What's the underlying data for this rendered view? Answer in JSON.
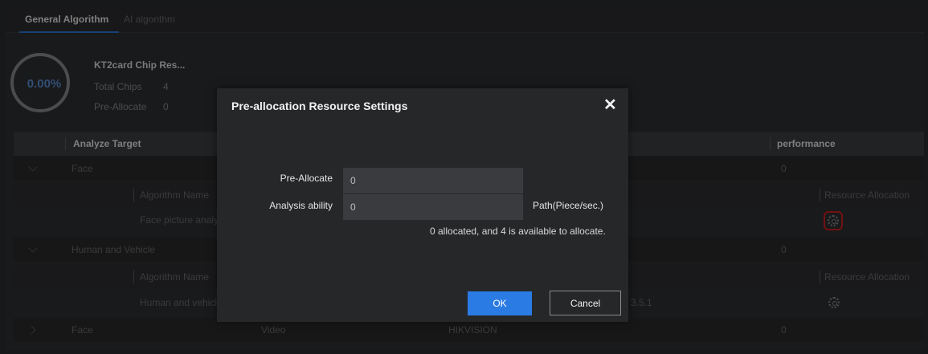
{
  "tabs": [
    {
      "label": "General Algorithm",
      "active": true
    },
    {
      "label": "AI algorithm",
      "active": false
    }
  ],
  "resource": {
    "percent": "0.00%",
    "title": "KT2card Chip Res...",
    "total_label": "Total Chips",
    "total_value": "4",
    "preallocate_label": "Pre-Allocate",
    "preallocate_value": "0"
  },
  "table": {
    "headers": {
      "analyze_target": "Analyze Target",
      "performance": "performance"
    },
    "groups": [
      {
        "name": "Face",
        "performance": "0",
        "sub_header_name": "Algorithm Name",
        "sub_header_resource": "Resource Allocation",
        "row_name": "Face picture analy"
      },
      {
        "name": "Human and Vehicle",
        "performance": "0",
        "sub_header_name": "Algorithm Name",
        "sub_header_resource": "Resource Allocation",
        "row_name": "Human and vehicl",
        "row_version": "3.5.1"
      },
      {
        "name": "Face",
        "source": "Video",
        "vendor": "HIKVISION",
        "performance": "0"
      }
    ]
  },
  "modal": {
    "title": "Pre-allocation Resource Settings",
    "close_glyph": "✕",
    "preallocate_label": "Pre-Allocate",
    "preallocate_value": "0",
    "analysis_label": "Analysis ability",
    "analysis_value": "0",
    "analysis_suffix": "Path(Piece/sec.)",
    "hint": "0 allocated, and 4 is available to allocate.",
    "ok_label": "OK",
    "cancel_label": "Cancel"
  },
  "colors": {
    "accent": "#2a7be4",
    "highlight": "#d01f1f"
  }
}
